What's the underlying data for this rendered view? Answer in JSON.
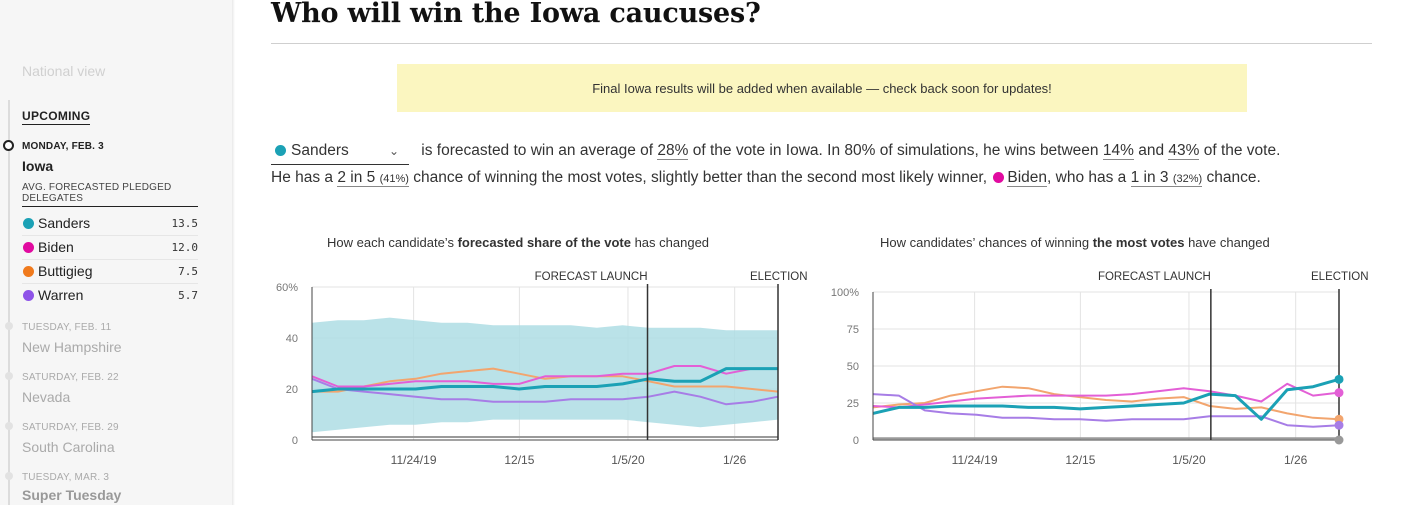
{
  "sidebar": {
    "national_view": "National view",
    "upcoming": "UPCOMING",
    "active_event": {
      "date": "MONDAY, FEB. 3",
      "state": "Iowa"
    },
    "delegates_header": "AVG. FORECASTED PLEDGED DELEGATES",
    "delegates": [
      {
        "name": "Sanders",
        "value": "13.5",
        "color": "#1ba1b5"
      },
      {
        "name": "Biden",
        "value": "12.0",
        "color": "#e10ba0"
      },
      {
        "name": "Buttigieg",
        "value": "7.5",
        "color": "#f07a1d"
      },
      {
        "name": "Warren",
        "value": "5.7",
        "color": "#8e53e8"
      }
    ],
    "events": [
      {
        "date": "TUESDAY, FEB. 11",
        "state": "New Hampshire"
      },
      {
        "date": "SATURDAY, FEB. 22",
        "state": "Nevada"
      },
      {
        "date": "SATURDAY, FEB. 29",
        "state": "South Carolina"
      },
      {
        "date": "TUESDAY, MAR. 3",
        "state": "Super Tuesday"
      }
    ]
  },
  "page": {
    "title": "Who will win the Iowa caucuses?",
    "notice": "Final Iowa results will be added when available — check back soon for updates!"
  },
  "summary": {
    "selected_candidate": "Sanders",
    "t1": " is forecasted to win an average of ",
    "avg_share": "28%",
    "t2": " of the vote in Iowa. In 80% of simulations, he wins between ",
    "low": "14%",
    "t3": " and ",
    "high": "43%",
    "t4": " of the vote.",
    "t5": "He has a ",
    "odds": "2 in 5",
    "odds_pct": "(41%)",
    "t6": " chance of winning the most votes, slightly better than the second most likely winner, ",
    "runner_up": "Biden",
    "t7": ", who has a ",
    "runner_odds": "1 in 3",
    "runner_pct": "(32%)",
    "t8": " chance."
  },
  "chart_data": [
    {
      "type": "line",
      "title_pre": "How each candidate’s ",
      "title_bold": "forecasted share of the vote",
      "title_post": " has changed",
      "x_ticks": [
        "11/24/19",
        "12/15",
        "1/5/20",
        "1/26"
      ],
      "y_ticks": [
        "60%",
        "40",
        "20",
        "0"
      ],
      "ylim": [
        0,
        60
      ],
      "annotations": [
        "FORECAST LAUNCH",
        "ELECTION"
      ],
      "grid": true,
      "band": {
        "upper": [
          46,
          47,
          47,
          48,
          47,
          46,
          46,
          45,
          45,
          45,
          45,
          44,
          45,
          44,
          44,
          44,
          43,
          43,
          43
        ],
        "lower": [
          3,
          4,
          5,
          6,
          6,
          7,
          7,
          8,
          8,
          8,
          8,
          8,
          8,
          7,
          6,
          5,
          6,
          7,
          8
        ]
      },
      "series": [
        {
          "name": "Buttigieg",
          "color": "#f2a56e",
          "values": [
            19,
            19,
            21,
            23,
            24,
            26,
            27,
            28,
            26,
            24,
            25,
            25,
            25,
            23,
            21,
            21,
            21,
            20,
            19
          ]
        },
        {
          "name": "Biden",
          "color": "#e35fd6",
          "values": [
            25,
            21,
            21,
            22,
            23,
            23,
            23,
            22,
            22,
            25,
            25,
            25,
            26,
            26,
            29,
            29,
            26,
            28,
            28
          ]
        },
        {
          "name": "Warren",
          "color": "#a77de6",
          "values": [
            24,
            20,
            19,
            18,
            17,
            16,
            16,
            15,
            15,
            15,
            16,
            16,
            16,
            17,
            19,
            17,
            14,
            15,
            17
          ]
        },
        {
          "name": "Sanders",
          "color": "#1ba1b5",
          "values": [
            19,
            20,
            20,
            20,
            20,
            21,
            21,
            21,
            20,
            21,
            21,
            21,
            22,
            24,
            23,
            23,
            28,
            28,
            28
          ]
        }
      ]
    },
    {
      "type": "line",
      "title_pre": "How candidates’ chances of winning ",
      "title_bold": "the most votes",
      "title_post": " have changed",
      "x_ticks": [
        "11/24/19",
        "12/15",
        "1/5/20",
        "1/26"
      ],
      "y_ticks": [
        "100%",
        "75",
        "50",
        "25",
        "0"
      ],
      "ylim": [
        0,
        100
      ],
      "annotations": [
        "FORECAST LAUNCH",
        "ELECTION"
      ],
      "grid": true,
      "series": [
        {
          "name": "Buttigieg",
          "color": "#f2a56e",
          "values": [
            22,
            24,
            25,
            30,
            33,
            36,
            35,
            31,
            29,
            27,
            26,
            28,
            29,
            23,
            21,
            22,
            18,
            15,
            14
          ]
        },
        {
          "name": "Biden",
          "color": "#e35fd6",
          "values": [
            23,
            22,
            24,
            26,
            28,
            29,
            30,
            30,
            30,
            30,
            31,
            33,
            35,
            33,
            30,
            26,
            38,
            30,
            32
          ]
        },
        {
          "name": "Warren",
          "color": "#a77de6",
          "values": [
            31,
            30,
            20,
            18,
            17,
            15,
            15,
            14,
            14,
            13,
            14,
            14,
            14,
            16,
            16,
            16,
            10,
            9,
            10
          ]
        },
        {
          "name": "Sanders",
          "color": "#1ba1b5",
          "values": [
            18,
            22,
            22,
            23,
            23,
            23,
            22,
            22,
            21,
            22,
            23,
            24,
            25,
            31,
            30,
            14,
            34,
            36,
            41
          ]
        }
      ]
    }
  ]
}
